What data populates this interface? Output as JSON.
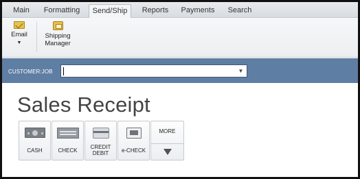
{
  "ribbon": {
    "tabs": [
      {
        "label": "Main"
      },
      {
        "label": "Formatting"
      },
      {
        "label": "Send/Ship"
      },
      {
        "label": "Reports"
      },
      {
        "label": "Payments"
      },
      {
        "label": "Search"
      }
    ],
    "active_tab": "Send/Ship",
    "buttons": {
      "email": "Email",
      "shipping_line1": "Shipping",
      "shipping_line2": "Manager"
    }
  },
  "customer_job": {
    "label": "CUSTOMER:JOB",
    "value": ""
  },
  "form": {
    "title": "Sales Receipt"
  },
  "payment_methods": {
    "cash": "CASH",
    "check": "CHECK",
    "credit_line1": "CREDIT",
    "credit_line2": "DEBIT",
    "echeck": "e-CHECK",
    "more": "MORE"
  },
  "colors": {
    "customer_bar": "#5f7ea3",
    "tab_bar": "#e0e3e7"
  }
}
